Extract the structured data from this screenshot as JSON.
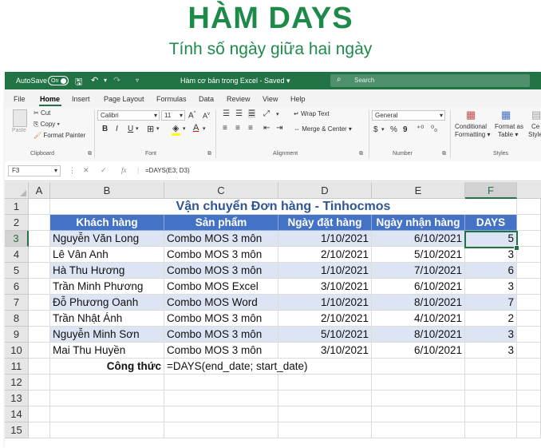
{
  "banner": {
    "title": "HÀM DAYS",
    "subtitle": "Tính số ngày giữa hai ngày"
  },
  "titlebar": {
    "autosave": "AutoSave",
    "toggle": "On",
    "document": "Hàm cơ bản trong Excel - Saved ▾",
    "search_placeholder": "Search"
  },
  "menu": [
    "File",
    "Home",
    "Insert",
    "Page Layout",
    "Formulas",
    "Data",
    "Review",
    "View",
    "Help"
  ],
  "ribbon": {
    "clipboard": {
      "paste": "Paste",
      "cut": "Cut",
      "copy": "Copy ▾",
      "format_painter": "Format Painter",
      "group": "Clipboard"
    },
    "font": {
      "name": "Calibri",
      "size": "11",
      "grow": "A",
      "shrink": "A",
      "bold": "B",
      "italic": "I",
      "underline": "U",
      "group": "Font"
    },
    "alignment": {
      "wrap": "Wrap Text",
      "merge": "Merge & Center",
      "group": "Alignment"
    },
    "number": {
      "format": "General",
      "currency": "$",
      "percent": "%",
      "comma": "9",
      "group": "Number"
    },
    "styles": {
      "conditional": "Conditional",
      "formatting": "Formatting ▾",
      "format_as": "Format as",
      "table": "Table ▾",
      "cell": "Ce",
      "styles_short": "Style",
      "group": "Styles"
    }
  },
  "formula_bar": {
    "cell_ref": "F3",
    "fx": "fx",
    "formula": "=DAYS(E3; D3)"
  },
  "columns": [
    "A",
    "B",
    "C",
    "D",
    "E",
    "F"
  ],
  "rows": [
    "1",
    "2",
    "3",
    "4",
    "5",
    "6",
    "7",
    "8",
    "9",
    "10",
    "11",
    "12",
    "13",
    "14",
    "15"
  ],
  "sheet": {
    "title": "Vận chuyển Đơn hàng - Tinhocmos",
    "headers": [
      "Khách hàng",
      "Sản phẩm",
      "Ngày đặt hàng",
      "Ngày nhận hàng",
      "DAYS"
    ],
    "data": [
      [
        "Nguyễn Văn Long",
        "Combo MOS 3 môn",
        "1/10/2021",
        "6/10/2021",
        "5"
      ],
      [
        "Lê Vân Anh",
        "Combo MOS 3 môn",
        "2/10/2021",
        "5/10/2021",
        "3"
      ],
      [
        "Hà Thu Hương",
        "Combo MOS 3 môn",
        "1/10/2021",
        "7/10/2021",
        "6"
      ],
      [
        "Trần Minh Phương",
        "Combo MOS Excel",
        "3/10/2021",
        "6/10/2021",
        "3"
      ],
      [
        "Đỗ Phương Oanh",
        "Combo MOS Word",
        "1/10/2021",
        "8/10/2021",
        "7"
      ],
      [
        "Trần Nhật Ánh",
        "Combo MOS 3 môn",
        "2/10/2021",
        "4/10/2021",
        "2"
      ],
      [
        "Nguyễn Minh Sơn",
        "Combo MOS 3 môn",
        "5/10/2021",
        "8/10/2021",
        "3"
      ],
      [
        "Mai Thu Huyền",
        "Combo MOS 3 môn",
        "3/10/2021",
        "6/10/2021",
        "3"
      ]
    ],
    "formula_label": "Công thức",
    "formula_text": "=DAYS(end_date; start_date)"
  },
  "colors": {
    "excel_green": "#217346",
    "banner_green": "#1e8a4a",
    "header_blue": "#4472c4",
    "band_blue": "#dde4f3",
    "title_blue": "#2f5597"
  }
}
